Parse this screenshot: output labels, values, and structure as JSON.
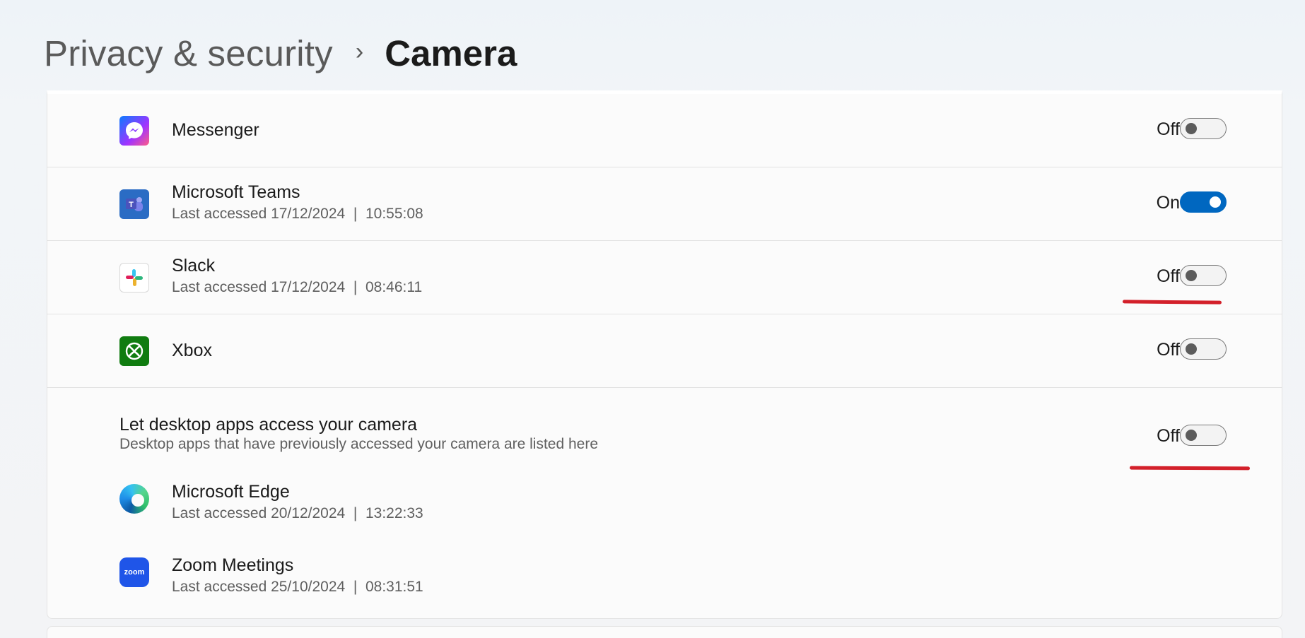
{
  "breadcrumb": {
    "parent": "Privacy & security",
    "separator": "›",
    "current": "Camera"
  },
  "apps": [
    {
      "name": "Messenger",
      "sub": "",
      "state": "Off",
      "on": false,
      "icon": "messenger-icon"
    },
    {
      "name": "Microsoft Teams",
      "sub": "Last accessed 17/12/2024  |  10:55:08",
      "state": "On",
      "on": true,
      "icon": "teams-icon"
    },
    {
      "name": "Slack",
      "sub": "Last accessed 17/12/2024  |  08:46:11",
      "state": "Off",
      "on": false,
      "icon": "slack-icon"
    },
    {
      "name": "Xbox",
      "sub": "",
      "state": "Off",
      "on": false,
      "icon": "xbox-icon"
    }
  ],
  "desktop": {
    "title": "Let desktop apps access your camera",
    "subtitle": "Desktop apps that have previously accessed your camera are listed here",
    "state": "Off",
    "on": false,
    "apps": [
      {
        "name": "Microsoft Edge",
        "sub": "Last accessed 20/12/2024  |  13:22:33",
        "icon": "edge-icon",
        "icon_text": ""
      },
      {
        "name": "Zoom Meetings",
        "sub": "Last accessed 25/10/2024  |  08:31:51",
        "icon": "zoom-icon",
        "icon_text": "zoom"
      }
    ]
  },
  "colors": {
    "accent": "#0067c0",
    "annotation": "#d3202a"
  }
}
